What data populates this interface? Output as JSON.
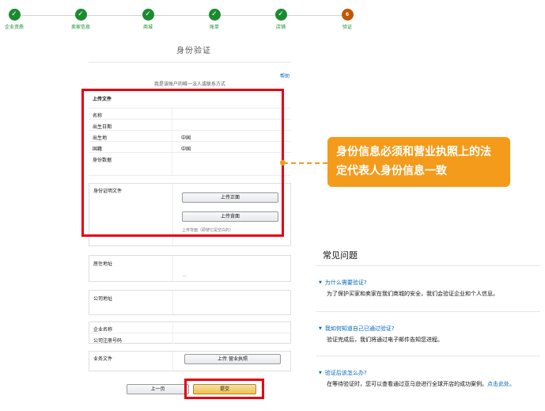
{
  "stepper": {
    "steps": [
      {
        "label": "企业资质",
        "mark": "✓"
      },
      {
        "label": "卖家信息",
        "mark": "✓"
      },
      {
        "label": "商城",
        "mark": "✓"
      },
      {
        "label": "账单",
        "mark": "✓"
      },
      {
        "label": "店铺",
        "mark": "✓"
      },
      {
        "label": "验证",
        "mark": "6"
      }
    ],
    "current_step": 6,
    "colors": {
      "done": "#1a8b2f",
      "current": "#c45500"
    }
  },
  "page": {
    "title": "身份验证",
    "help_link": "帮助",
    "intro": "我是该账户的唯一法人或联系方式"
  },
  "upload_section": {
    "heading": "上传文件",
    "rows": [
      {
        "label": "名称",
        "value": ""
      },
      {
        "label": "出生日期",
        "value": ""
      },
      {
        "label": "出生地",
        "value": "中国"
      },
      {
        "label": "国籍",
        "value": "中国"
      },
      {
        "label": "身份数据",
        "value": ""
      }
    ]
  },
  "id_docs": {
    "label": "身份证明文件",
    "upload_front": "上传正面",
    "upload_back": "上传背面",
    "hint": "上传背面（即使它是空白的）"
  },
  "residence": {
    "label": "居住地址",
    "value": "…"
  },
  "company_address": {
    "label": "公司地址"
  },
  "company": {
    "name_label": "企业名称",
    "reg_label": "公司注册号码"
  },
  "business_docs": {
    "label": "业务文件",
    "upload": "上传 营业执照"
  },
  "actions": {
    "back": "上一页",
    "submit": "提交"
  },
  "callout": {
    "text": "身份信息必须和营业执照上的法定代表人身份信息一致",
    "color": "#f49b1b"
  },
  "faq": {
    "title": "常见问题",
    "items": [
      {
        "q": "为什么需要验证?",
        "a": "为了保护买家和卖家在我们商城的安全，我们会验证企业和个人信息。",
        "more": ""
      },
      {
        "q": "我如何知道自己已通过验证?",
        "a": "验证完成后，我们将通过电子邮件告知您进程。",
        "more": ""
      },
      {
        "q": "验证后该怎么办?",
        "a": "在等待验证时，您可以查看通过亚马逊进行全球开店的成功案例。",
        "more": "点击此处。"
      }
    ]
  },
  "highlight_color": "#e60012"
}
